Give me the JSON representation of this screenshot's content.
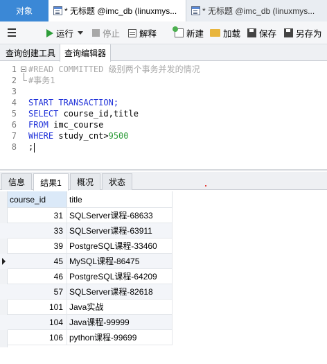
{
  "window_tabs": {
    "objects_label": "对象",
    "active_tab_label": "* 无标题 @imc_db (linuxmys...",
    "inactive_tab_label": "* 无标题 @imc_db (linuxmys..."
  },
  "toolbar": {
    "run": "运行",
    "stop": "停止",
    "explain": "解释",
    "new": "新建",
    "load": "加载",
    "save": "保存",
    "save_as": "另存为"
  },
  "sub_tabs": {
    "query_builder": "查询创建工具",
    "query_editor": "查询编辑器"
  },
  "editor": {
    "line_numbers": [
      "1",
      "2",
      "3",
      "4",
      "5",
      "6",
      "7",
      "8"
    ],
    "line1": "#READ COMMITTED 级别两个事务并发的情况",
    "line2": "#事务1",
    "line4": "START TRANSACTION;",
    "line5_kw": "SELECT",
    "line5_rest": " course_id,title",
    "line6_kw": "FROM",
    "line6_rest": " imc_course",
    "line7_kw": "WHERE",
    "line7_rest": " study_cnt>",
    "line7_num": "9500",
    "line8": ";"
  },
  "result_tabs": [
    "信息",
    "结果1",
    "概况",
    "状态"
  ],
  "active_result_tab": "结果1",
  "grid": {
    "columns": [
      "course_id",
      "title"
    ],
    "rows": [
      {
        "course_id": "31",
        "title": "SQLServer课程-68633"
      },
      {
        "course_id": "33",
        "title": "SQLServer课程-63911"
      },
      {
        "course_id": "39",
        "title": "PostgreSQL课程-33460"
      },
      {
        "course_id": "45",
        "title": "MySQL课程-86475"
      },
      {
        "course_id": "46",
        "title": "PostgreSQL课程-64209"
      },
      {
        "course_id": "57",
        "title": "SQLServer课程-82618"
      },
      {
        "course_id": "101",
        "title": "Java实战"
      },
      {
        "course_id": "104",
        "title": "Java课程-99999"
      },
      {
        "course_id": "106",
        "title": "python课程-99699"
      }
    ],
    "current_row_index": 3
  },
  "colors": {
    "objects_tab": "#3b88d6",
    "keyword": "#1f31d9",
    "comment": "#a8a8a8",
    "number": "#2e9d3a",
    "run_icon": "#2e9d3a"
  }
}
